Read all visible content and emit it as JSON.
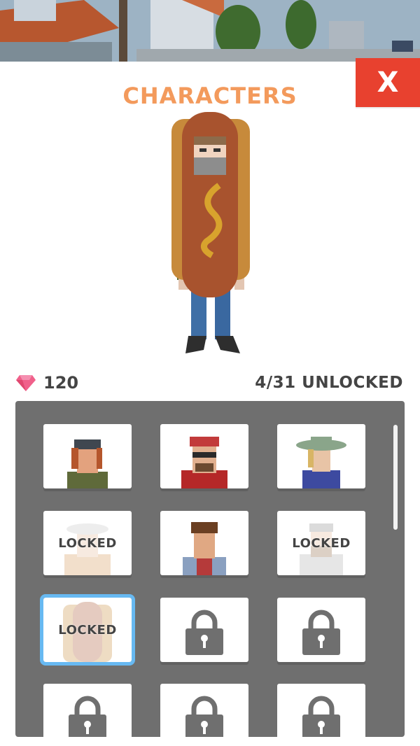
{
  "header": {
    "title": "CHARACTERS",
    "close_label": "X"
  },
  "stats": {
    "gems": "120",
    "unlocked": "4/31 UNLOCKED"
  },
  "cards": [
    {
      "state": "unlocked",
      "label": ""
    },
    {
      "state": "unlocked",
      "label": ""
    },
    {
      "state": "unlocked",
      "label": ""
    },
    {
      "state": "locked-preview",
      "label": "LOCKED"
    },
    {
      "state": "unlocked",
      "label": ""
    },
    {
      "state": "locked-preview",
      "label": "LOCKED"
    },
    {
      "state": "locked-preview",
      "label": "LOCKED"
    },
    {
      "state": "locked",
      "label": ""
    },
    {
      "state": "locked",
      "label": ""
    },
    {
      "state": "locked",
      "label": ""
    },
    {
      "state": "locked",
      "label": ""
    },
    {
      "state": "locked",
      "label": ""
    }
  ],
  "colors": {
    "accent": "#f39a5c",
    "close": "#e8412f",
    "selection": "#67b9f2",
    "gem": "#f0608a"
  }
}
